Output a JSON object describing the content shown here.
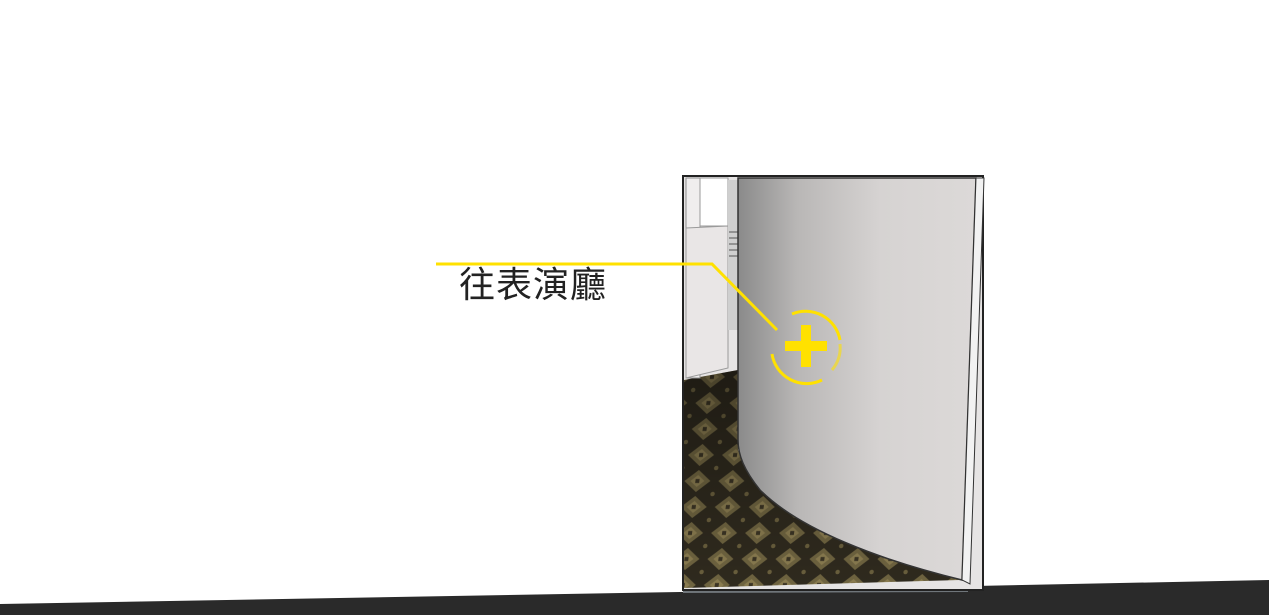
{
  "hotspot": {
    "label": "往表演廳",
    "icon": "plus-circle-icon",
    "color": "#ffe100"
  },
  "colors": {
    "background": "#ffffff",
    "ground": "#2a2a2a",
    "carpet_dark": "#2f2a1e",
    "carpet_light": "#8a7c50",
    "wall_light": "#dcd9d8",
    "wall_dark": "#8c8c8c"
  }
}
